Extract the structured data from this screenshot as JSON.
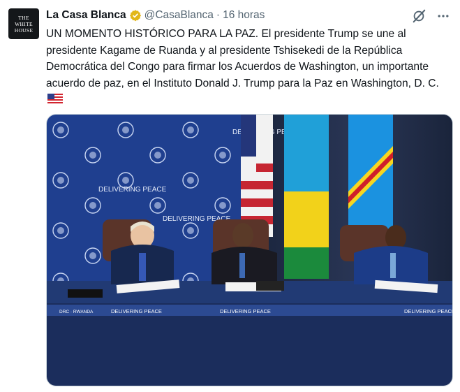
{
  "author": {
    "display_name": "La Casa Blanca",
    "handle": "@CasaBlanca",
    "separator": "·",
    "time": "16 horas",
    "avatar_line1": "THE",
    "avatar_line2": "WHITE",
    "avatar_line3": "HOUSE"
  },
  "tweet": {
    "text": "UN MOMENTO HISTÓRICO PARA LA PAZ. El presidente Trump se une al presidente Kagame de Ruanda y al presidente Tshisekedi de la República Democrática del Congo para firmar los Acuerdos de Washington, un importante acuerdo de paz, en el Instituto Donald J. Trump para la Paz en Washington, D. C."
  },
  "photo": {
    "backdrop_text": "DELIVERING PEACE",
    "table_skirt_text": "DELIVERING PEACE",
    "placard_text": "DRC · RWANDA"
  },
  "icons": {
    "verified": "verified-badge-icon",
    "grok": "grok-icon",
    "more": "more-icon",
    "flag": "us-flag-icon"
  },
  "colors": {
    "text": "#0f1419",
    "secondary": "#536471",
    "verified_gold": "#e2b719",
    "backdrop_blue": "#1f3f8f",
    "table_navy": "#1b2d5c"
  }
}
